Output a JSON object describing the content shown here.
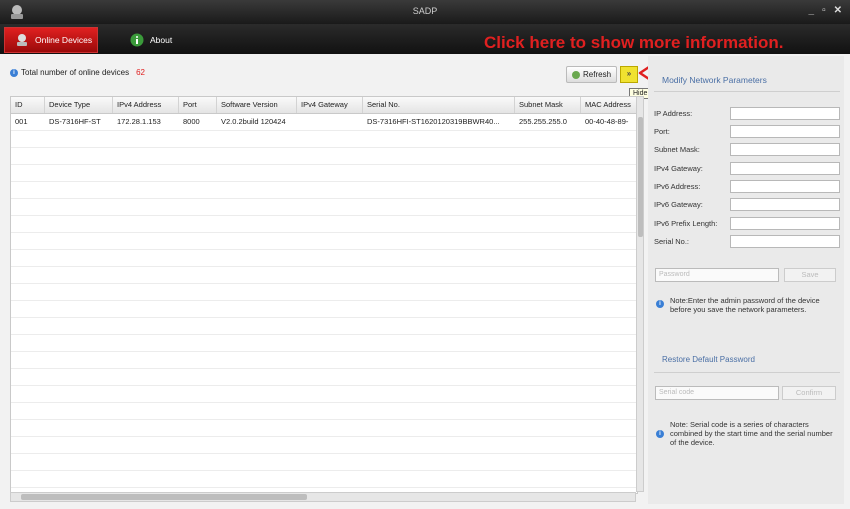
{
  "window": {
    "title": "SADP",
    "minimize": "_",
    "restore": "▫",
    "close": "✕"
  },
  "tabs": [
    {
      "label": "Online Devices"
    },
    {
      "label": "About"
    }
  ],
  "hint": "Click here to show more information.",
  "device_list": {
    "total_label": "Total number of online devices",
    "total_count": "62",
    "refresh_label": "Refresh",
    "collapse_label": "»",
    "tooltip": "Hide",
    "columns": [
      "ID",
      "Device Type",
      "IPv4 Address",
      "Port",
      "Software Version",
      "IPv4 Gateway",
      "Serial No.",
      "Subnet Mask",
      "MAC Address"
    ],
    "rows": [
      [
        "001",
        "DS-7316HF-ST",
        "172.28.1.153",
        "8000",
        "V2.0.2build 120424",
        "",
        "DS-7316HFI-ST1620120319BBWR40...",
        "255.255.255.0",
        "00-40-48-89-"
      ]
    ]
  },
  "modify_panel": {
    "title": "Modify Network Parameters",
    "fields": [
      {
        "label": "IP Address:"
      },
      {
        "label": "Port:"
      },
      {
        "label": "Subnet Mask:"
      },
      {
        "label": "IPv4 Gateway:"
      },
      {
        "label": "IPv6 Address:"
      },
      {
        "label": "IPv6 Gateway:"
      },
      {
        "label": "IPv6 Prefix Length:"
      },
      {
        "label": "Serial No.:"
      }
    ],
    "password_placeholder": "Password",
    "save_label": "Save",
    "note_save": "Note:Enter the admin password of the device before you save the network parameters.",
    "restore_link": "Restore Default Password",
    "serial_code_placeholder": "Serial code",
    "confirm_label": "Confirm",
    "note_serial": "Note: Serial code is a series of characters combined by the start time and the serial number of the device."
  }
}
